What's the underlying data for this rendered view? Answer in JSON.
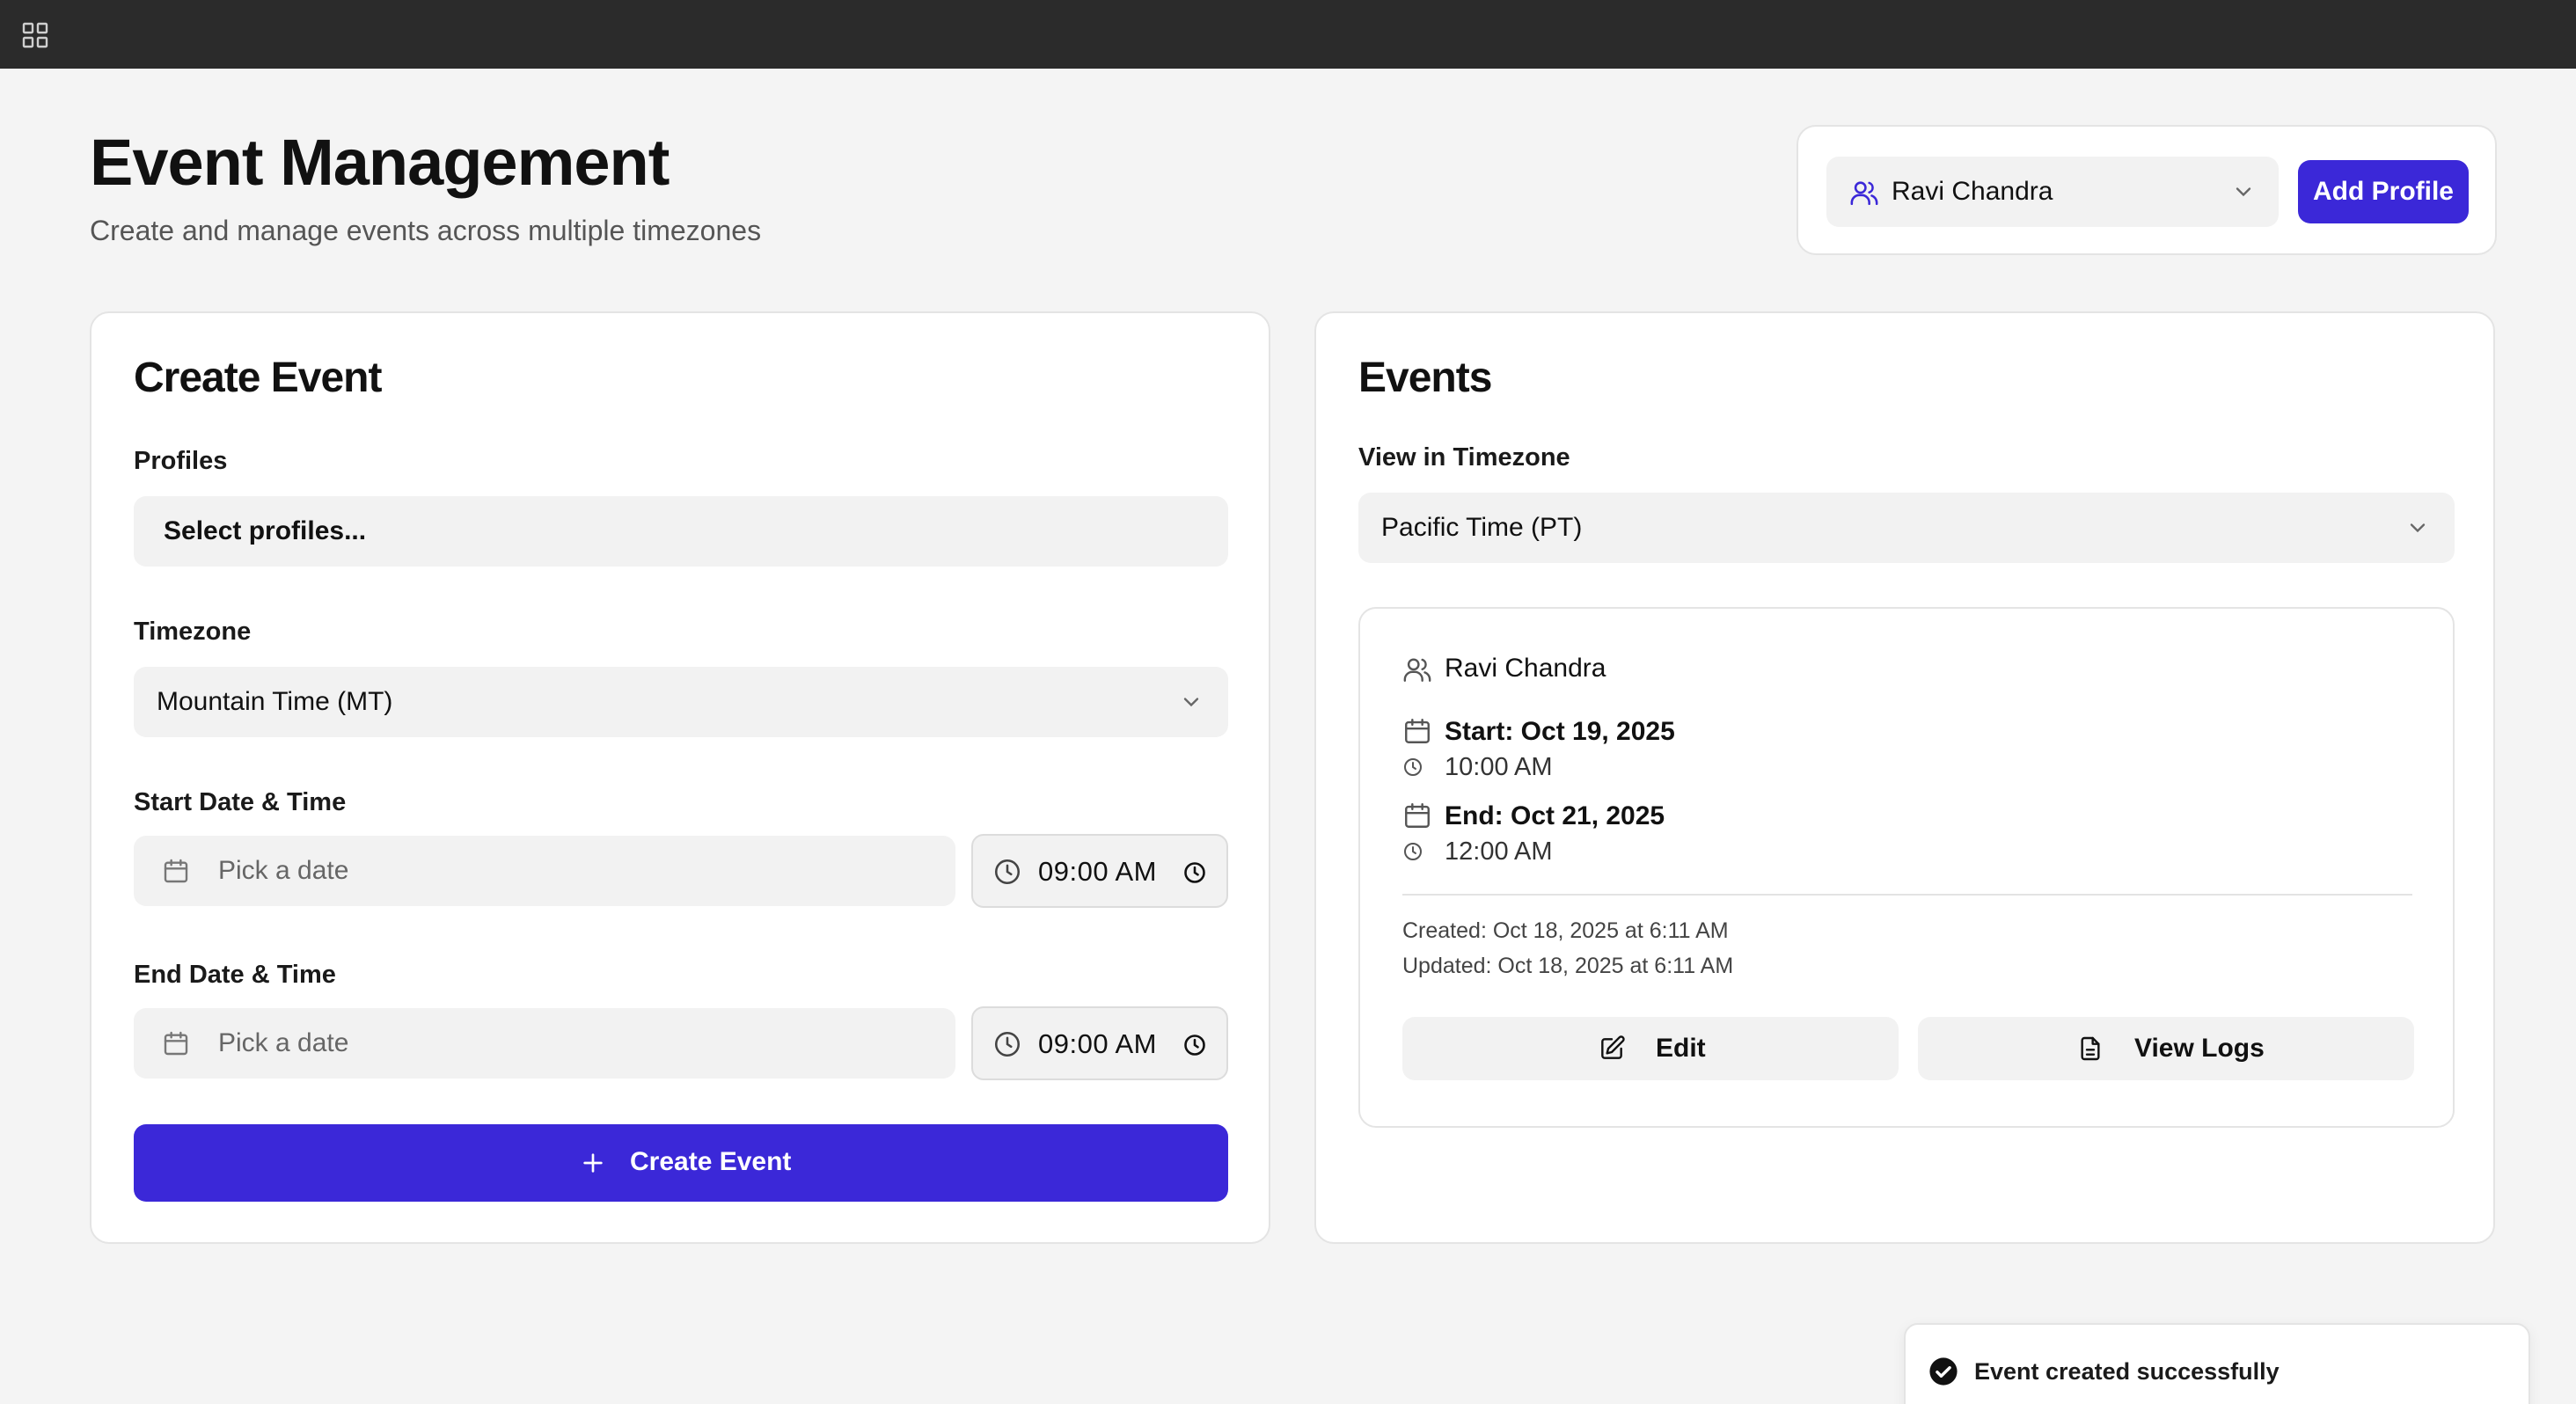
{
  "app": {
    "icons": {
      "apps": "apps-grid-icon"
    }
  },
  "header": {
    "title": "Event Management",
    "subtitle": "Create and manage events across multiple timezones"
  },
  "profile_bar": {
    "selected_profile": "Ravi Chandra",
    "add_profile_label": "Add Profile",
    "accent_color": "#3b28d8"
  },
  "create_event": {
    "title": "Create Event",
    "profiles_label": "Profiles",
    "profiles_placeholder": "Select profiles...",
    "timezone_label": "Timezone",
    "timezone_value": "Mountain Time (MT)",
    "start_label": "Start Date & Time",
    "start_date_placeholder": "Pick a date",
    "start_time": "09:00 AM",
    "end_label": "End Date & Time",
    "end_date_placeholder": "Pick a date",
    "end_time": "09:00 AM",
    "submit_label": "Create Event"
  },
  "events": {
    "title": "Events",
    "view_tz_label": "View in Timezone",
    "view_tz_value": "Pacific Time (PT)",
    "items": [
      {
        "profile": "Ravi Chandra",
        "start": "Start: Oct 19, 2025",
        "start_time": "10:00 AM",
        "end": "End: Oct 21, 2025",
        "end_time": "12:00 AM",
        "created": "Created: Oct 18, 2025 at 6:11 AM",
        "updated": "Updated: Oct 18, 2025 at 6:11 AM",
        "edit_label": "Edit",
        "logs_label": "View Logs"
      }
    ]
  },
  "toast": {
    "message": "Event created successfully"
  }
}
